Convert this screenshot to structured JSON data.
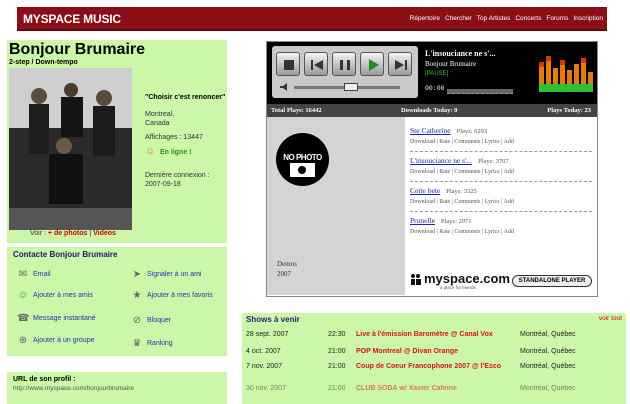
{
  "header": {
    "logo": "MYSPACE MUSIC",
    "nav": [
      "Répertoire",
      "Chercher",
      "Top Artistes",
      "Concerts",
      "Forums",
      "Inscription"
    ]
  },
  "profile": {
    "name": "Bonjour Brumaire",
    "genre": "2-step / Down-tempo",
    "quote": "\"Choisir c'est renoncer\"",
    "city": "Montreal,",
    "country": "Canada",
    "views": "Affichages : 13447",
    "online": "En ligne !",
    "last_login_label": "Dernière connexion :",
    "last_login_date": "2007-09-18",
    "view_label": "Voir :",
    "photos_link": "+ de photos",
    "separator": "|",
    "videos_link": "Videos"
  },
  "contact": {
    "title": "Contacte Bonjour Brumaire",
    "items": [
      {
        "label": "Email",
        "icon": "mail-icon"
      },
      {
        "label": "Signaler à un ami",
        "icon": "forward-icon"
      },
      {
        "label": "Ajouter à mes amis",
        "icon": "add-friend-icon"
      },
      {
        "label": "Ajouter à mes favoris",
        "icon": "favorites-icon"
      },
      {
        "label": "Message instantané",
        "icon": "im-icon"
      },
      {
        "label": "Bloquer",
        "icon": "block-icon"
      },
      {
        "label": "Ajouter à un groupe",
        "icon": "group-icon"
      },
      {
        "label": "Ranking",
        "icon": "ranking-icon"
      }
    ]
  },
  "url": {
    "label": "URL de son profil :",
    "value": "http://www.myspace.com/bonjourbrumaire"
  },
  "player": {
    "now_title": "L'insouciance ne s'...",
    "now_artist": "Bonjour Brumaire",
    "mode": "[PAUSE]",
    "time": "00:00",
    "total_plays": "Total Plays: 16442",
    "downloads_today": "Downloads Today: 0",
    "plays_today": "Plays Today: 23",
    "no_photo": "NO PHOTO",
    "album_name": "Demos",
    "album_year": "2007",
    "brand": "myspace.com",
    "brand_tag": "a place for friends",
    "standalone": "STANDALONE PLAYER",
    "tracks": [
      {
        "name": "Ste Catherine",
        "plays": "Plays: 6293"
      },
      {
        "name": "L'insouciance ne s'...",
        "plays": "Plays: 3707"
      },
      {
        "name": "Cette bete",
        "plays": "Plays: 3325"
      },
      {
        "name": "Prunelle",
        "plays": "Plays: 2971"
      }
    ],
    "actions": [
      "Download",
      "Rate",
      "Comments",
      "Lyrics",
      "Add"
    ]
  },
  "shows": {
    "title": "Shows à venir",
    "all_link": "voir tout",
    "rows": [
      {
        "date": "28 sept. 2007",
        "time": "22:30",
        "venue": "Live à l'émission Baromètre @ Canal Vox",
        "city": "Montréal, Québec"
      },
      {
        "date": "4 oct. 2007",
        "time": "21:00",
        "venue": "POP Montreal @ Divan Orange",
        "city": "Montréal, Québec"
      },
      {
        "date": "7 nov. 2007",
        "time": "21:00",
        "venue": "Coup de Coeur Francophone 2007 @ l'Esco",
        "city": "Montréal, Québec"
      },
      {
        "date": "30 nov. 2007",
        "time": "21:00",
        "venue": "CLUB SODA w/ Xavier Cafeine",
        "city": "Montréal, Québec"
      }
    ]
  },
  "colors": {
    "header_bg": "#8b0e16",
    "panel_bg": "#ccf7a8",
    "link_red": "#d8170d",
    "link_blue": "#1a2a9a"
  }
}
